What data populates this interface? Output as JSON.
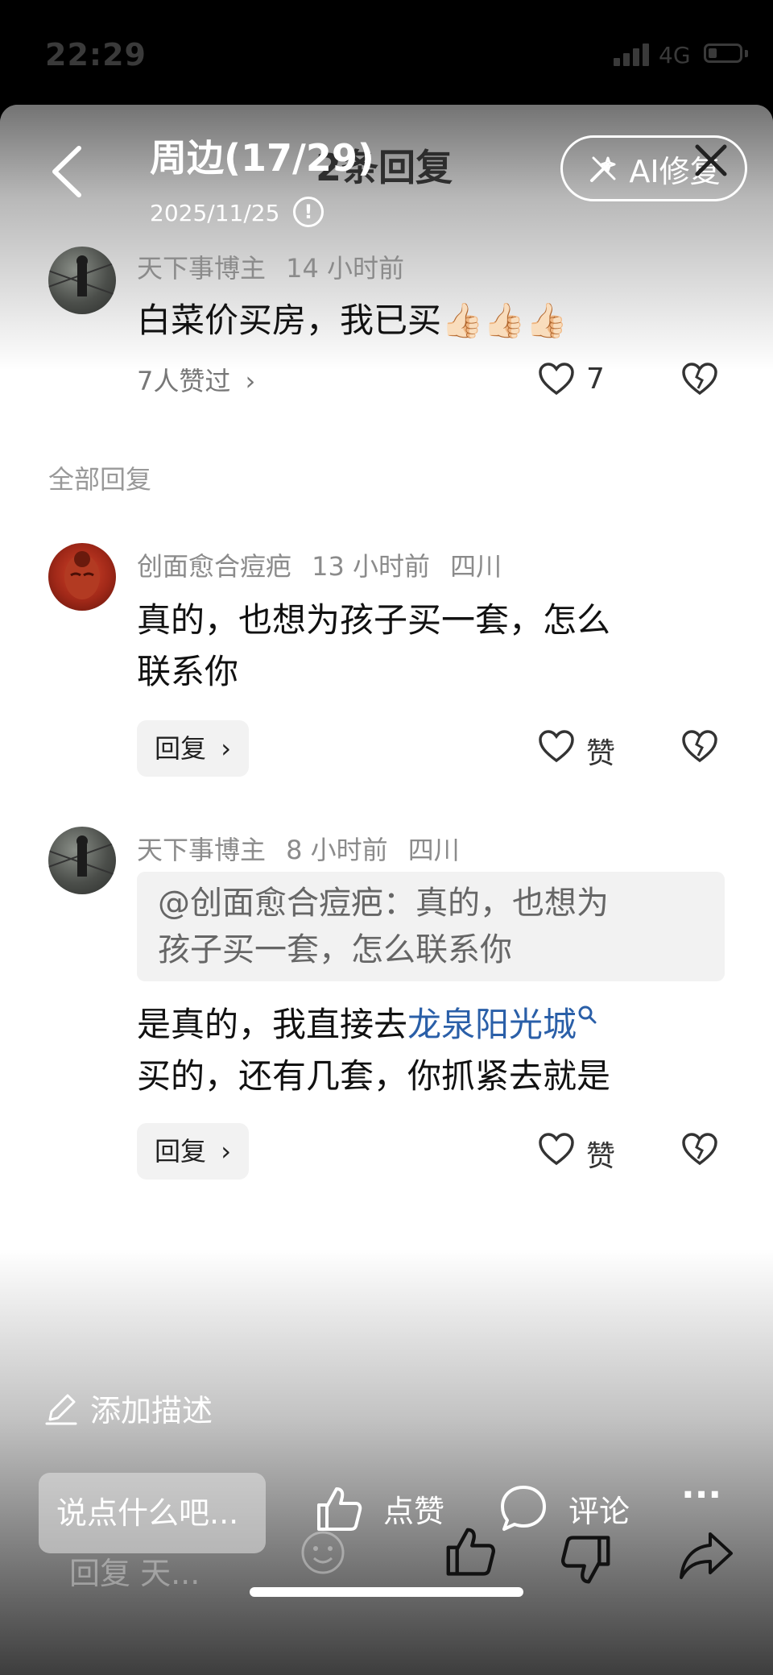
{
  "status_bar": {
    "time": "22:29",
    "network": "4G"
  },
  "header": {
    "title": "周边(17/29)",
    "date": "2025/11/25",
    "reply_count": "2条回复",
    "ai_button": "AI修复"
  },
  "main_comment": {
    "username": "天下事博主",
    "time": "14 小时前",
    "text": "白菜价买房，我已买👍🏻👍🏻👍🏻",
    "likers": "7人赞过",
    "like_count": "7"
  },
  "section_label": "全部回复",
  "replies": [
    {
      "username": "创面愈合痘疤",
      "time": "13 小时前",
      "location": "四川",
      "text_line1": "真的，也想为孩子买一套，怎么",
      "text_line2": "联系你",
      "reply_label": "回复",
      "like_label": "赞"
    },
    {
      "username": "天下事博主",
      "time": "8 小时前",
      "location": "四川",
      "quote_line1": "@创面愈合痘疤：真的，也想为",
      "quote_line2": "孩子买一套，怎么联系你",
      "text_prefix": "是真的，我直接去",
      "text_link": "龙泉阳光城",
      "text_line2": "买的，还有几套，你抓紧去就是",
      "reply_label": "回复",
      "like_label": "赞"
    }
  ],
  "bottom": {
    "add_description": "添加描述",
    "input_placeholder": "说点什么吧...",
    "reply_ghost": "回复 天...",
    "like_label": "点赞",
    "comment_label": "评论",
    "more_label": "···"
  },
  "icons": {
    "back": "chevron-left-icon",
    "info": "info-icon",
    "ai": "magic-wand-icon",
    "close": "close-icon",
    "heart": "heart-icon",
    "dislike": "broken-heart-icon",
    "edit": "pencil-icon",
    "thumb": "thumb-up-icon",
    "comment": "comment-bubble-icon",
    "share": "share-icon"
  }
}
